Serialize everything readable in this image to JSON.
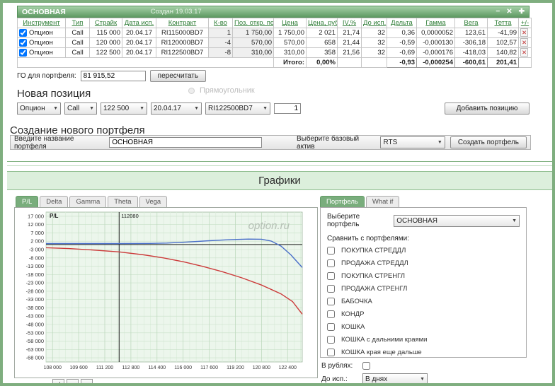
{
  "window": {
    "title": "ОСНОВНАЯ",
    "created": "Создан 19.03.17",
    "minimize": "−",
    "close": "✕",
    "add": "✚"
  },
  "positions_table": {
    "headers": [
      "Инструмент",
      "Тип",
      "Страйк",
      "Дата исп.",
      "Контракт",
      "К-во",
      "Поз. откр. по",
      "Цена",
      "Цена, руб.",
      "IV,%",
      "До исп.",
      "Дельта",
      "Гамма",
      "Вега",
      "Тетта",
      "+/-"
    ],
    "rows": [
      {
        "instrument": "Опцион",
        "type": "Call",
        "strike": "115 000",
        "exp_date": "20.04.17",
        "contract": "RI115000BD7",
        "qty": "1",
        "pos_open": "1 750,00",
        "price": "1 750,00",
        "price_rub": "2 021",
        "iv": "21,74",
        "days": "32",
        "delta": "0,36",
        "gamma": "0,0000052",
        "vega": "123,61",
        "theta": "-41,99"
      },
      {
        "instrument": "Опцион",
        "type": "Call",
        "strike": "120 000",
        "exp_date": "20.04.17",
        "contract": "RI120000BD7",
        "qty": "-4",
        "pos_open": "570,00",
        "price": "570,00",
        "price_rub": "658",
        "iv": "21,44",
        "days": "32",
        "delta": "-0,59",
        "gamma": "-0,000130",
        "vega": "-306,18",
        "theta": "102,57"
      },
      {
        "instrument": "Опцион",
        "type": "Call",
        "strike": "122 500",
        "exp_date": "20.04.17",
        "contract": "RI122500BD7",
        "qty": "-8",
        "pos_open": "310,00",
        "price": "310,00",
        "price_rub": "358",
        "iv": "21,56",
        "days": "32",
        "delta": "-0,69",
        "gamma": "-0,000176",
        "vega": "-418,03",
        "theta": "140,82"
      }
    ],
    "totals": {
      "label": "Итого:",
      "pl_percent": "0,00%",
      "delta": "-0,93",
      "gamma": "-0,000254",
      "vega": "-600,61",
      "theta": "201,41"
    }
  },
  "margin": {
    "label": "ГО для портфеля:",
    "value": "81 915,52",
    "recalc": "пересчитать"
  },
  "overlay": {
    "label": "Прямоугольник"
  },
  "new_position": {
    "heading": "Новая позиция",
    "type": "Опцион",
    "callput": "Call",
    "strike": "122 500",
    "date": "20.04.17",
    "contract": "RI122500BD7",
    "qty": "1",
    "add_button": "Добавить позицию"
  },
  "new_portfolio": {
    "heading": "Создание нового портфеля",
    "name_label": "Введите название портфеля",
    "name_value": "ОСНОВНАЯ",
    "asset_label": "Выберите базовый актив",
    "asset_value": "RTS",
    "create_button": "Создать портфель"
  },
  "charts": {
    "heading": "Графики",
    "tabs": [
      "P/L",
      "Delta",
      "Gamma",
      "Theta",
      "Vega"
    ],
    "active_tab": "P/L",
    "pager": [
      "«|",
      "«",
      "»"
    ]
  },
  "right_panel": {
    "tabs": [
      "Портфель",
      "What if"
    ],
    "active_tab": "Портфель",
    "select_label": "Выберите портфель",
    "select_value": "ОСНОВНАЯ",
    "compare_label": "Сравнить с портфелями:",
    "compare_items": [
      "ПОКУПКА СТРЕДДЛ",
      "ПРОДАЖА СТРЕДДЛ",
      "ПОКУПКА СТРЕНГЛ",
      "ПРОДАЖА СТРЕНГЛ",
      "БАБОЧКА",
      "КОНДР",
      "КОШКА",
      "КОШКА с дальними краями",
      "КОШКА края еще дальше"
    ],
    "rubles_label": "В рублях:",
    "days_label": "До исп.:",
    "days_value": "В днях"
  },
  "chart_data": {
    "type": "line",
    "title": "P/L",
    "watermark": "option.ru",
    "xlim": [
      107600,
      123300
    ],
    "ylim": [
      -70500,
      19500
    ],
    "x_minor_step": 400,
    "x_ticks": [
      "108 000",
      "109 600",
      "111 200",
      "112 800",
      "114 400",
      "116 000",
      "117 600",
      "119 200",
      "120 800",
      "122 400"
    ],
    "y_ticks": [
      "17 000",
      "12 000",
      "7 000",
      "2 000",
      "-3 000",
      "-8 000",
      "-13 000",
      "-18 000",
      "-23 000",
      "-28 000",
      "-33 000",
      "-38 000",
      "-43 000",
      "-48 000",
      "-53 000",
      "-58 000",
      "-63 000",
      "-68 000"
    ],
    "zero_line": 0,
    "marker_x": 112080,
    "marker_label": "112080",
    "series": [
      {
        "name": "blue-line",
        "color": "#4a6fc9",
        "points": [
          [
            107600,
            600
          ],
          [
            110000,
            600
          ],
          [
            112080,
            620
          ],
          [
            114000,
            700
          ],
          [
            115000,
            900
          ],
          [
            116200,
            1500
          ],
          [
            117600,
            2300
          ],
          [
            118800,
            2900
          ],
          [
            120000,
            3300
          ],
          [
            120800,
            3200
          ],
          [
            121400,
            2100
          ],
          [
            122000,
            -900
          ],
          [
            122600,
            -6200
          ],
          [
            123300,
            -13800
          ]
        ]
      },
      {
        "name": "red-line",
        "color": "#cc3b3b",
        "points": [
          [
            107600,
            -1900
          ],
          [
            109000,
            -2400
          ],
          [
            110400,
            -3200
          ],
          [
            112080,
            -4400
          ],
          [
            113600,
            -6200
          ],
          [
            114800,
            -8000
          ],
          [
            116000,
            -10300
          ],
          [
            117200,
            -13100
          ],
          [
            118400,
            -16300
          ],
          [
            119600,
            -20000
          ],
          [
            120800,
            -24300
          ],
          [
            122000,
            -29600
          ],
          [
            122700,
            -34200
          ],
          [
            123300,
            -41800
          ]
        ]
      }
    ]
  }
}
